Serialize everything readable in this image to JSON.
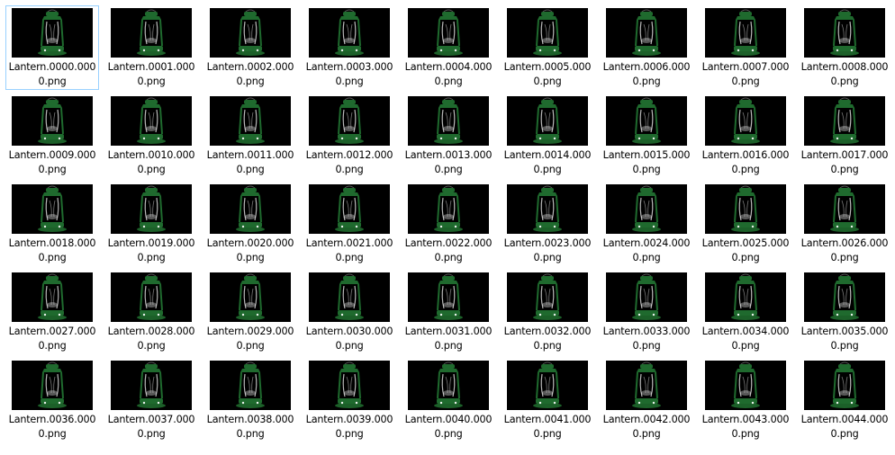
{
  "view": {
    "files": [
      {
        "name_line1": "Lantern.0000.000",
        "name_line2": "0.png",
        "selected": true
      },
      {
        "name_line1": "Lantern.0001.000",
        "name_line2": "0.png"
      },
      {
        "name_line1": "Lantern.0002.000",
        "name_line2": "0.png"
      },
      {
        "name_line1": "Lantern.0003.000",
        "name_line2": "0.png"
      },
      {
        "name_line1": "Lantern.0004.000",
        "name_line2": "0.png"
      },
      {
        "name_line1": "Lantern.0005.000",
        "name_line2": "0.png"
      },
      {
        "name_line1": "Lantern.0006.000",
        "name_line2": "0.png"
      },
      {
        "name_line1": "Lantern.0007.000",
        "name_line2": "0.png"
      },
      {
        "name_line1": "Lantern.0008.000",
        "name_line2": "0.png"
      },
      {
        "name_line1": "Lantern.0009.000",
        "name_line2": "0.png"
      },
      {
        "name_line1": "Lantern.0010.000",
        "name_line2": "0.png"
      },
      {
        "name_line1": "Lantern.0011.000",
        "name_line2": "0.png"
      },
      {
        "name_line1": "Lantern.0012.000",
        "name_line2": "0.png"
      },
      {
        "name_line1": "Lantern.0013.000",
        "name_line2": "0.png"
      },
      {
        "name_line1": "Lantern.0014.000",
        "name_line2": "0.png"
      },
      {
        "name_line1": "Lantern.0015.000",
        "name_line2": "0.png"
      },
      {
        "name_line1": "Lantern.0016.000",
        "name_line2": "0.png"
      },
      {
        "name_line1": "Lantern.0017.000",
        "name_line2": "0.png"
      },
      {
        "name_line1": "Lantern.0018.000",
        "name_line2": "0.png"
      },
      {
        "name_line1": "Lantern.0019.000",
        "name_line2": "0.png"
      },
      {
        "name_line1": "Lantern.0020.000",
        "name_line2": "0.png"
      },
      {
        "name_line1": "Lantern.0021.000",
        "name_line2": "0.png"
      },
      {
        "name_line1": "Lantern.0022.000",
        "name_line2": "0.png"
      },
      {
        "name_line1": "Lantern.0023.000",
        "name_line2": "0.png"
      },
      {
        "name_line1": "Lantern.0024.000",
        "name_line2": "0.png"
      },
      {
        "name_line1": "Lantern.0025.000",
        "name_line2": "0.png"
      },
      {
        "name_line1": "Lantern.0026.000",
        "name_line2": "0.png"
      },
      {
        "name_line1": "Lantern.0027.000",
        "name_line2": "0.png"
      },
      {
        "name_line1": "Lantern.0028.000",
        "name_line2": "0.png"
      },
      {
        "name_line1": "Lantern.0029.000",
        "name_line2": "0.png"
      },
      {
        "name_line1": "Lantern.0030.000",
        "name_line2": "0.png"
      },
      {
        "name_line1": "Lantern.0031.000",
        "name_line2": "0.png"
      },
      {
        "name_line1": "Lantern.0032.000",
        "name_line2": "0.png"
      },
      {
        "name_line1": "Lantern.0033.000",
        "name_line2": "0.png"
      },
      {
        "name_line1": "Lantern.0034.000",
        "name_line2": "0.png"
      },
      {
        "name_line1": "Lantern.0035.000",
        "name_line2": "0.png"
      },
      {
        "name_line1": "Lantern.0036.000",
        "name_line2": "0.png"
      },
      {
        "name_line1": "Lantern.0037.000",
        "name_line2": "0.png"
      },
      {
        "name_line1": "Lantern.0038.000",
        "name_line2": "0.png"
      },
      {
        "name_line1": "Lantern.0039.000",
        "name_line2": "0.png"
      },
      {
        "name_line1": "Lantern.0040.000",
        "name_line2": "0.png"
      },
      {
        "name_line1": "Lantern.0041.000",
        "name_line2": "0.png"
      },
      {
        "name_line1": "Lantern.0042.000",
        "name_line2": "0.png"
      },
      {
        "name_line1": "Lantern.0043.000",
        "name_line2": "0.png"
      },
      {
        "name_line1": "Lantern.0044.000",
        "name_line2": "0.png"
      }
    ]
  },
  "colors": {
    "selection_border": "#99d1ff",
    "thumb_background": "#000000",
    "lantern_green": "#1f6a2e",
    "lantern_glass": "#d8d8d8"
  }
}
